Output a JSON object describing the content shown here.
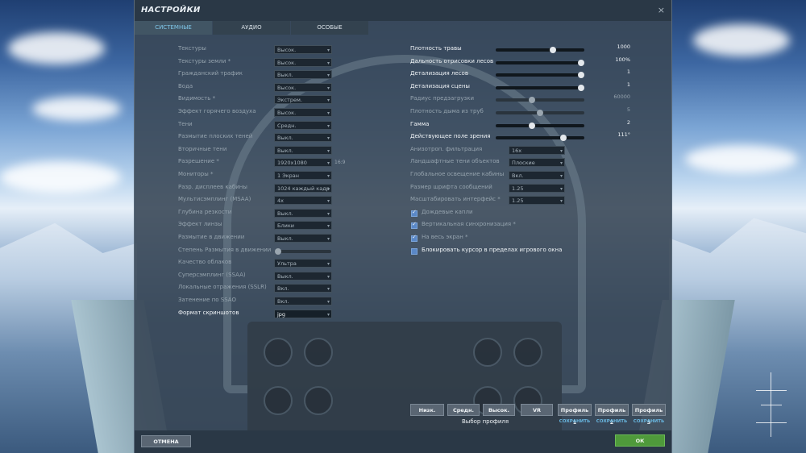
{
  "window": {
    "title": "НАСТРОЙКИ",
    "close_glyph": "×"
  },
  "tabs": [
    {
      "label": "СИСТЕМНЫЕ",
      "active": true
    },
    {
      "label": "АУДИО",
      "active": false
    },
    {
      "label": "ОСОБЫЕ",
      "active": false
    }
  ],
  "left_settings": [
    {
      "label": "Текстуры",
      "value": "Высок.",
      "dim": true
    },
    {
      "label": "Текстуры земли *",
      "value": "Высок.",
      "dim": true
    },
    {
      "label": "Гражданский трафик",
      "value": "Выкл.",
      "dim": true
    },
    {
      "label": "Вода",
      "value": "Высок.",
      "dim": true
    },
    {
      "label": "Видимость *",
      "value": "Экстрем.",
      "dim": true
    },
    {
      "label": "Эффект горячего воздуха",
      "value": "Высок.",
      "dim": true
    },
    {
      "label": "Тени",
      "value": "Средн.",
      "dim": true
    },
    {
      "label": "Размытие плоских теней",
      "value": "Выкл.",
      "dim": true
    },
    {
      "label": "Вторичные тени",
      "value": "Выкл.",
      "dim": true
    },
    {
      "label": "Разрешение *",
      "value": "1920x1080",
      "dim": true,
      "extra": "16:9"
    },
    {
      "label": "Мониторы *",
      "value": "1 Экран",
      "dim": true
    },
    {
      "label": "Разр. дисплеев кабины",
      "value": "1024 каждый кадр",
      "dim": true
    },
    {
      "label": "Мультисэмплинг (MSAA)",
      "value": "4x",
      "dim": true
    },
    {
      "label": "Глубина резкости",
      "value": "Выкл.",
      "dim": true
    },
    {
      "label": "Эффект линзы",
      "value": "Блики",
      "dim": true
    },
    {
      "label": "Размытие в движении",
      "value": "Выкл.",
      "dim": true
    },
    {
      "label": "Степень Размытия в движении",
      "slider": true,
      "value": "",
      "dim": true
    },
    {
      "label": "Качество облаков",
      "value": "Ультра",
      "dim": true
    },
    {
      "label": "Суперсэмплинг (SSAA)",
      "value": "Выкл.",
      "dim": true
    },
    {
      "label": "Локальные отражения (SSLR)",
      "value": "Вкл.",
      "dim": true
    },
    {
      "label": "Затенение по SSAO",
      "value": "Вкл.",
      "dim": true
    },
    {
      "label": "Формат скриншотов",
      "value": "jpg",
      "dim": false
    }
  ],
  "right_sliders": [
    {
      "label": "Плотность травы",
      "value": "1000",
      "pos": 0.66,
      "dim": false
    },
    {
      "label": "Дальность отрисовки лесов",
      "value": "100%",
      "pos": 1.0,
      "dim": false
    },
    {
      "label": "Детализация лесов",
      "value": "1",
      "pos": 1.0,
      "dim": false
    },
    {
      "label": "Детализация сцены",
      "value": "1",
      "pos": 1.0,
      "dim": false
    },
    {
      "label": "Радиус предзагрузки",
      "value": "60000",
      "pos": 0.4,
      "dim": true
    },
    {
      "label": "Плотность дыма из труб",
      "value": "5",
      "pos": 0.5,
      "dim": true
    },
    {
      "label": "Гамма",
      "value": "2",
      "pos": 0.4,
      "dim": false
    },
    {
      "label": "Действующее поле зрения",
      "value": "111°",
      "pos": 0.78,
      "dim": false
    }
  ],
  "right_selects": [
    {
      "label": "Анизотроп. фильтрация",
      "value": "16x"
    },
    {
      "label": "Ландшафтные тени объектов",
      "value": "Плоские"
    },
    {
      "label": "Глобальное освещение кабины",
      "value": "Вкл."
    },
    {
      "label": "Размер шрифта сообщений",
      "value": "1.25"
    },
    {
      "label": "Масштабировать интерфейс *",
      "value": "1.25"
    }
  ],
  "checkboxes": [
    {
      "label": "Дождевые капли",
      "checked": true,
      "dim": true
    },
    {
      "label": "Вертикальная синхронизация *",
      "checked": true,
      "dim": true
    },
    {
      "label": "На весь экран *",
      "checked": true,
      "dim": true
    },
    {
      "label": "Блокировать курсор в пределах игрового окна",
      "checked": false,
      "dim": false
    }
  ],
  "presets": {
    "buttons": [
      "Низк.",
      "Средн.",
      "Высок.",
      "VR"
    ],
    "caption": "Выбор профиля",
    "profiles": [
      {
        "label": "Профиль 1",
        "save": "СОХРАНИТЬ"
      },
      {
        "label": "Профиль 2",
        "save": "СОХРАНИТЬ"
      },
      {
        "label": "Профиль 3",
        "save": "СОХРАНИТЬ"
      }
    ]
  },
  "footer": {
    "cancel_label": "ОТМЕНА",
    "ok_label": "ОК"
  },
  "colors": {
    "accent_tab": "#7fc6e8",
    "ok_button": "#4f9a3b",
    "save_link": "#69b9e3",
    "checkbox": "#5a88c7"
  }
}
